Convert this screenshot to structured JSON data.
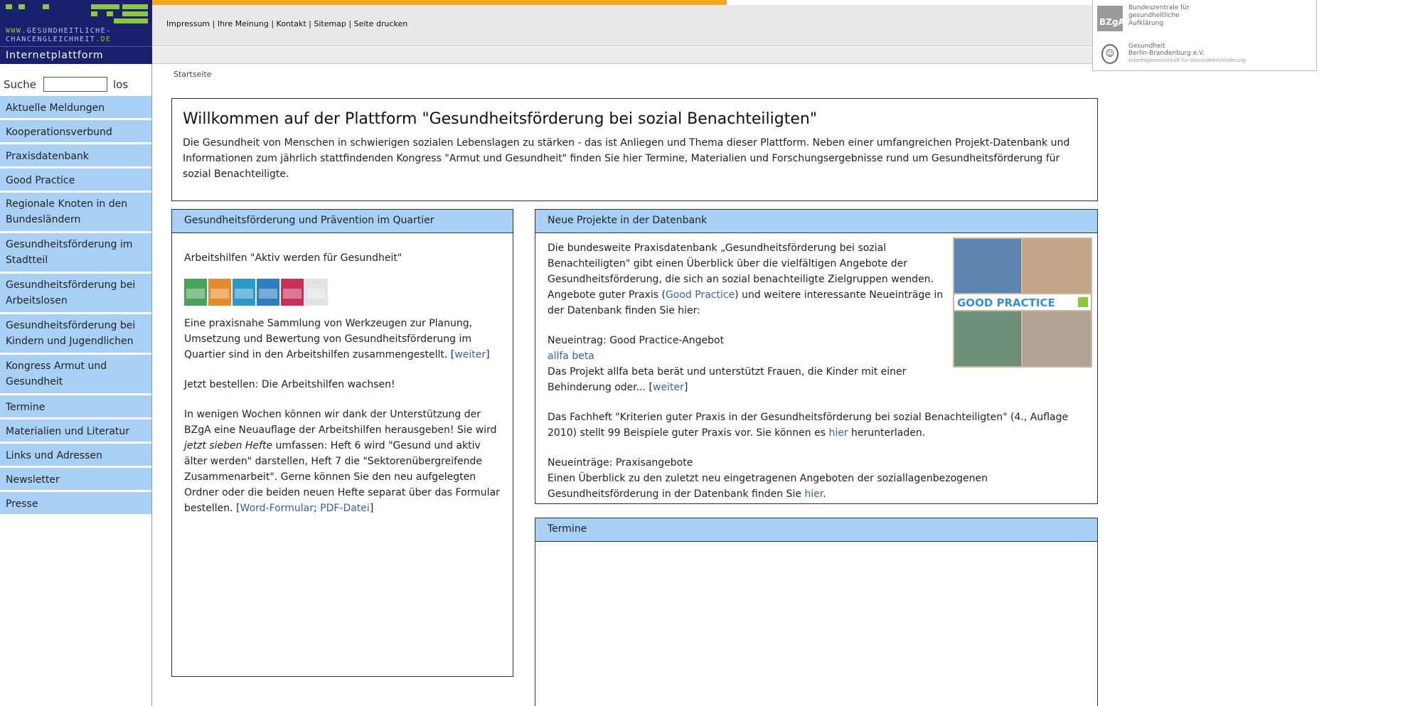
{
  "logo": {
    "line1_prefix": "WWW.",
    "line1_rest": "GESUNDHEITLICHE-",
    "line2_rest": "CHANCENGLEICHHEIT",
    "line2_suffix": ".DE",
    "platform": "Internetplattform"
  },
  "utility_nav": {
    "items": [
      "Impressum",
      "Ihre Meinung",
      "Kontakt",
      "Sitemap",
      "Seite drucken"
    ],
    "separator": " | "
  },
  "partners": {
    "bzga_short": "BZgA",
    "bzga_name": [
      "Bundeszentrale für",
      "gesundheitliche",
      "Aufklärung"
    ],
    "gbb_name": [
      "Gesundheit",
      "Berlin-Brandenburg e.V."
    ],
    "gbb_sub": "Arbeitsgemeinschaft für Gesundheitsförderung"
  },
  "search": {
    "label": "Suche",
    "value": "",
    "button": "los"
  },
  "sidebar": {
    "items": [
      "Aktuelle Meldungen",
      "Kooperationsverbund",
      "Praxisdatenbank",
      "Good Practice",
      "Regionale Knoten in den Bundesländern",
      "Gesundheitsförderung im Stadtteil",
      "Gesundheitsförderung bei Arbeitslosen",
      "Gesundheitsförderung bei Kindern und Jugendlichen",
      "Kongress Armut und Gesundheit",
      "Termine",
      "Materialien und Literatur",
      "Links und Adressen",
      "Newsletter",
      "Presse"
    ]
  },
  "breadcrumb": "Startseite",
  "welcome": {
    "title": "Willkommen auf der Plattform \"Gesundheitsförderung bei sozial Benachteiligten\"",
    "text": "Die Gesundheit von Menschen in schwierigen sozialen Lebenslagen zu stärken - das ist Anliegen und Thema dieser Plattform. Neben einer umfangreichen Projekt-Datenbank und Informationen zum jährlich stattfindenden Kongress \"Armut und Gesundheit\" finden Sie hier Termine, Materialien und Forschungsergebnisse rund um Gesundheitsförderung für sozial Benachteiligte."
  },
  "quartier": {
    "header": "Gesundheitsförderung und Prävention im Quartier",
    "subtitle": "Arbeitshilfen \"Aktiv werden für Gesundheit\"",
    "cover_colors": [
      "#4aa35a",
      "#e58a2c",
      "#2b9ac8",
      "#2f7fbf",
      "#c8305a",
      "#e2e2e2"
    ],
    "para1": "Eine praxisnahe Sammlung von Werkzeugen zur Planung, Umsetzung und Bewertung von Gesundheitsförderung im Quartier sind in den Arbeitshilfen zusammengestellt.",
    "link_weiter": "weiter",
    "para2": "Jetzt bestellen: Die Arbeitshilfen wachsen!",
    "para3_a": "In wenigen Wochen können wir dank der Unterstützung der BZgA eine Neuauflage der Arbeitshilfen herausgeben! Sie wird ",
    "para3_em": "jetzt sieben Hefte",
    "para3_b": " umfassen: Heft 6 wird \"Gesund und aktiv älter werden\" darstellen, Heft 7 die \"Sektorenübergreifende Zusammenarbeit\". Gerne können Sie den neu aufgelegten Ordner oder die beiden neuen Hefte separat über das Formular bestellen.",
    "link_word": "Word-Formular",
    "link_pdf": "PDF-Datei"
  },
  "projekte": {
    "header": "Neue Projekte in der Datenbank",
    "intro_a": "Die bundesweite Praxisdatenbank „Gesundheitsförderung bei sozial Benachteiligten\" gibt einen Überblick über die vielfältigen Angebote der Gesundheitsförderung, die sich an sozial benachteiligte Zielgruppen wenden. Angebote guter Praxis (",
    "intro_link": "Good Practice",
    "intro_b": ") und weitere interessante Neueinträge in der Datenbank finden Sie hier:",
    "gp_label": "GOOD PRACTICE",
    "new_entry_title": "Neueintrag: Good Practice-Angebot",
    "new_entry_link": "allfa beta",
    "new_entry_text": "Das Projekt allfa beta berät und unterstützt Frauen, die Kinder mit einer Behinderung oder...",
    "link_weiter": "weiter",
    "fachheft_a": "Das Fachheft \"Kriterien guter Praxis in der Gesundheitsförderung bei sozial Benachteiligten\" (4., Auflage 2010) stellt 99 Beispiele guter Praxis vor. Sie können es ",
    "fachheft_link": "hier",
    "fachheft_b": " herunterladen.",
    "praxis_title": "Neueinträge: Praxisangebote",
    "praxis_a": "Einen Überblick zu den zuletzt neu eingetragenen Angeboten der soziallagenbezogenen Gesundheitsförderung in der Datenbank finden Sie ",
    "praxis_link": "hier",
    "praxis_b": "."
  },
  "termine": {
    "header": "Termine"
  },
  "colors": {
    "nav_bg": "#a8d0f4",
    "logo_bg": "#1a1f6e",
    "accent_green": "#8dc63f",
    "top_orange": "#f2a81d",
    "link": "#3a5fa8"
  }
}
